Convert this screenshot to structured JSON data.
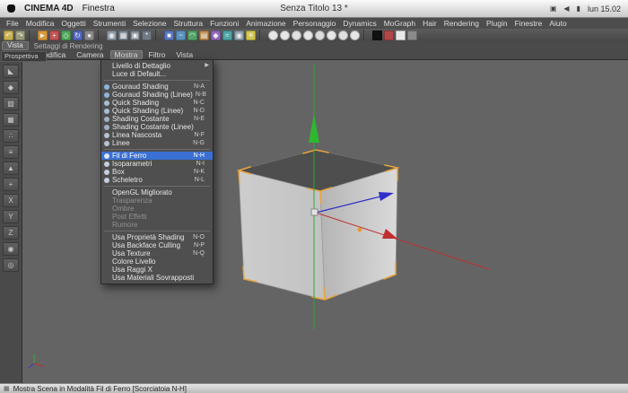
{
  "macos_menubar": {
    "app_name": "CINEMA 4D",
    "menu_item": "Finestra",
    "window_title": "Senza Titolo 13 *",
    "clock": "lun 15.02"
  },
  "app_menu": {
    "items": [
      "File",
      "Modifica",
      "Oggetti",
      "Strumenti",
      "Selezione",
      "Struttura",
      "Funzioni",
      "Animazione",
      "Personaggio",
      "Dynamics",
      "MoGraph",
      "Hair",
      "Rendering",
      "Plugin",
      "Finestre",
      "Aiuto"
    ]
  },
  "toolbar": {
    "icons": [
      {
        "name": "undo-icon",
        "glyph": "↶",
        "color": "#c9b04e"
      },
      {
        "name": "redo-icon",
        "glyph": "↷",
        "color": "#9a9a7a"
      },
      {
        "type": "sep"
      },
      {
        "name": "live-selection-icon",
        "glyph": "►",
        "color": "#d99a3c"
      },
      {
        "name": "move-icon",
        "glyph": "+",
        "color": "#c25454"
      },
      {
        "name": "scale-icon",
        "glyph": "◇",
        "color": "#4faa5c"
      },
      {
        "name": "rotate-icon",
        "glyph": "↻",
        "color": "#5568c4"
      },
      {
        "name": "last-tool-icon",
        "glyph": "●",
        "color": "#8a8a8a"
      },
      {
        "type": "sep"
      },
      {
        "name": "coordinate-system-icon",
        "glyph": "◉",
        "color": "#8b97a6"
      },
      {
        "name": "render-view-icon",
        "glyph": "▦",
        "color": "#7d8893"
      },
      {
        "name": "render-picture-viewer-icon",
        "glyph": "▣",
        "color": "#7d8893"
      },
      {
        "name": "render-settings-icon",
        "glyph": "*",
        "color": "#6f7a85"
      },
      {
        "type": "sep"
      },
      {
        "name": "add-primitive-icon",
        "glyph": "■",
        "color": "#5b77c2"
      },
      {
        "name": "add-spline-icon",
        "glyph": "~",
        "color": "#5b93c2"
      },
      {
        "name": "add-nurbs-icon",
        "glyph": "◠",
        "color": "#57a468"
      },
      {
        "name": "add-modeling-icon",
        "glyph": "▤",
        "color": "#bd8a4d"
      },
      {
        "name": "add-deformer-icon",
        "glyph": "◆",
        "color": "#9468bd"
      },
      {
        "name": "add-environment-icon",
        "glyph": "≈",
        "color": "#4da4a4"
      },
      {
        "name": "add-camera-icon",
        "glyph": "◉",
        "color": "#8fa0ae"
      },
      {
        "name": "add-light-icon",
        "glyph": "☀",
        "color": "#d4c44e"
      },
      {
        "type": "sep"
      },
      {
        "name": "material-sphere-icon",
        "color": "#e6e6e6",
        "shape": "circle"
      },
      {
        "name": "material-sphere-icon",
        "color": "#e6e6e6",
        "shape": "circle"
      },
      {
        "name": "material-sphere-icon",
        "color": "#e0e0e0",
        "shape": "circle"
      },
      {
        "name": "material-sphere-icon",
        "color": "#e6e6e6",
        "shape": "circle"
      },
      {
        "name": "material-sphere-icon",
        "color": "#dcdcdc",
        "shape": "circle"
      },
      {
        "name": "material-sphere-icon",
        "color": "#e6e6e6",
        "shape": "circle"
      },
      {
        "name": "material-sphere-icon",
        "color": "#e0e0e0",
        "shape": "circle"
      },
      {
        "name": "material-sphere-icon",
        "color": "#e6e6e6",
        "shape": "circle"
      },
      {
        "type": "sep"
      },
      {
        "name": "swatch-black",
        "color": "#101010",
        "shape": "square"
      },
      {
        "name": "swatch-colors",
        "color": "#b04848",
        "shape": "square"
      },
      {
        "name": "swatch-white",
        "color": "#e8e8e8",
        "shape": "square"
      },
      {
        "name": "swatch-gray",
        "color": "#8a8a8a",
        "shape": "square"
      }
    ]
  },
  "tabsrow": {
    "tab": "Vista",
    "label": "Settaggi di Rendering"
  },
  "viewport_menu": {
    "grid_icon": "▦",
    "items": [
      {
        "label": "Modifica"
      },
      {
        "label": "Camera"
      },
      {
        "label": "Mostra",
        "state": "active"
      },
      {
        "label": "Filtro"
      },
      {
        "label": "Vista"
      }
    ]
  },
  "viewport": {
    "label": "Prospettiva"
  },
  "left_rail": {
    "icons": [
      {
        "name": "make-editable-icon",
        "glyph": "◣"
      },
      {
        "name": "model-mode-icon",
        "glyph": "◆"
      },
      {
        "name": "texture-mode-icon",
        "glyph": "▨"
      },
      {
        "name": "workplane-icon",
        "glyph": "▦"
      },
      {
        "name": "points-mode-icon",
        "glyph": "∴"
      },
      {
        "name": "edges-mode-icon",
        "glyph": "≡"
      },
      {
        "name": "polygons-mode-icon",
        "glyph": "▲"
      },
      {
        "name": "axis-mode-icon",
        "glyph": "+"
      },
      {
        "name": "lock-x-icon",
        "glyph": "X"
      },
      {
        "name": "lock-y-icon",
        "glyph": "Y"
      },
      {
        "name": "lock-z-icon",
        "glyph": "Z"
      },
      {
        "name": "world-coordinates-icon",
        "glyph": "◉"
      },
      {
        "name": "snap-icon",
        "glyph": "◎"
      }
    ]
  },
  "viewport_dropdown": {
    "items": [
      {
        "label": "Livello di Dettaglio",
        "submenu": "▶"
      },
      {
        "label": "Luce di Default..."
      },
      {
        "type": "sep"
      },
      {
        "label": "Gouraud Shading",
        "shortcut": "N-A",
        "icon": "#8fb3dd"
      },
      {
        "label": "Gouraud Shading (Linee)",
        "shortcut": "N-B",
        "icon": "#8fb3dd"
      },
      {
        "label": "Quick Shading",
        "shortcut": "N-C",
        "icon": "#a8bdd6"
      },
      {
        "label": "Quick Shading (Linee)",
        "shortcut": "N-D",
        "icon": "#a8bdd6"
      },
      {
        "label": "Shading Costante",
        "shortcut": "N-E",
        "icon": "#9fb0c4"
      },
      {
        "label": "Shading Costante (Linee)",
        "icon": "#9fb0c4"
      },
      {
        "label": "Linea Nascosta",
        "shortcut": "N-F",
        "icon": "#b5c2d2"
      },
      {
        "label": "Linee",
        "shortcut": "N-G",
        "icon": "#b5c2d2"
      },
      {
        "type": "sep"
      },
      {
        "label": "Fil di Ferro",
        "shortcut": "N-H",
        "icon": "#dce6f4",
        "state": "hl"
      },
      {
        "label": "Isoparametri",
        "shortcut": "N-I",
        "icon": "#c4cede"
      },
      {
        "label": "Box",
        "shortcut": "N-K",
        "icon": "#c4cede"
      },
      {
        "label": "Scheletro",
        "shortcut": "N-L",
        "icon": "#c4cede"
      },
      {
        "type": "sep"
      },
      {
        "label": "OpenGL Migliorato"
      },
      {
        "label": "Trasparenza",
        "state": "dis"
      },
      {
        "label": "Ombre",
        "state": "dis"
      },
      {
        "label": "Post Effetti",
        "state": "dis"
      },
      {
        "label": "Rumore",
        "state": "dis"
      },
      {
        "type": "sep"
      },
      {
        "label": "Usa Proprietà Shading",
        "shortcut": "N-O"
      },
      {
        "label": "Usa Backface Culling",
        "shortcut": "N-P"
      },
      {
        "label": "Usa Texture",
        "shortcut": "N-Q"
      },
      {
        "label": "Colore Livello"
      },
      {
        "label": "Usa Raggi X"
      },
      {
        "label": "Usa Materiali Sovrapposti"
      }
    ]
  },
  "statusbar": {
    "icon": "▦",
    "text": "Mostra Scena in Modalità Fil di Ferro [Scorciatoia N-H]"
  },
  "colors": {
    "axis_x": "#c03030",
    "axis_y": "#2fb82f",
    "axis_z": "#2e2ec8",
    "selection_brackets": "#e8a33c",
    "menu_highlight": "#3a70d4",
    "viewport_background": "#646464"
  }
}
